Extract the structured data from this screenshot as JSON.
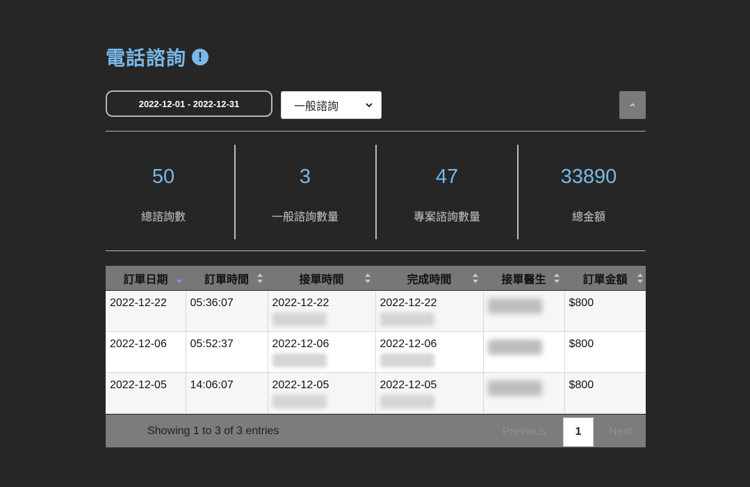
{
  "header": {
    "title": "電話諮詢",
    "info_icon_glyph": "!"
  },
  "filters": {
    "date_range": "2022-12-01 - 2022-12-31",
    "type_select_value": "一般諮詢"
  },
  "stats": [
    {
      "value": "50",
      "label": "總諮詢數"
    },
    {
      "value": "3",
      "label": "一般諮詢數量"
    },
    {
      "value": "47",
      "label": "專案諮詢數量"
    },
    {
      "value": "33890",
      "label": "總金額"
    }
  ],
  "table": {
    "columns": [
      "訂單日期",
      "訂單時間",
      "接單時間",
      "完成時間",
      "接單醫生",
      "訂單金額"
    ],
    "rows": [
      {
        "order_date": "2022-12-22",
        "order_time": "05:36:07",
        "accept_time": "2022-12-22",
        "complete_time": "2022-12-22",
        "amount": "$800"
      },
      {
        "order_date": "2022-12-06",
        "order_time": "05:52:37",
        "accept_time": "2022-12-06",
        "complete_time": "2022-12-06",
        "amount": "$800"
      },
      {
        "order_date": "2022-12-05",
        "order_time": "14:06:07",
        "accept_time": "2022-12-05",
        "complete_time": "2022-12-05",
        "amount": "$800"
      }
    ]
  },
  "pagination": {
    "info": "Showing 1 to 3 of 3 entries",
    "previous": "Previous",
    "current_page": "1",
    "next": "Next"
  },
  "colors": {
    "background": "#262626",
    "accent": "#79b8e8"
  }
}
